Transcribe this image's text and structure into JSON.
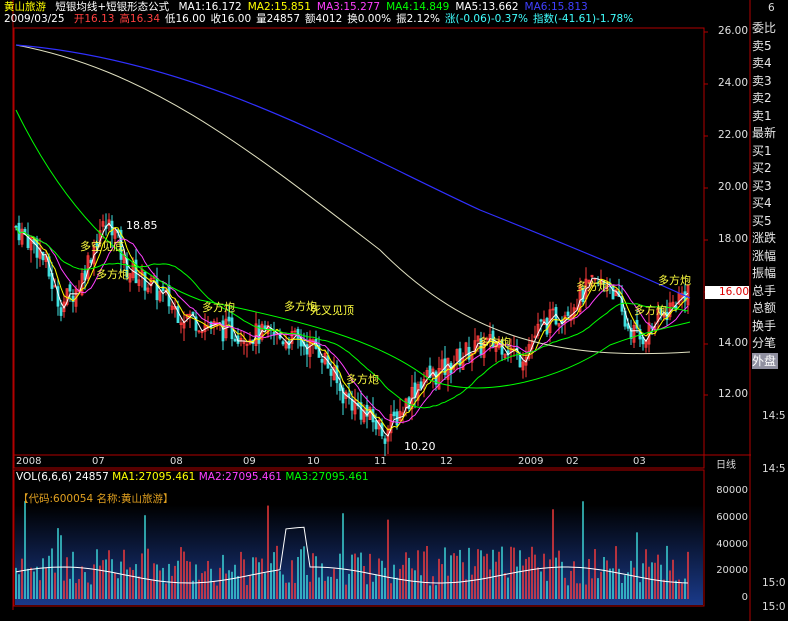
{
  "stock": {
    "name": "黄山旅游",
    "formula_name": "短银均线+短银形态公式",
    "date": "2009/03/25",
    "code_line": "【代码:600054  名称:黄山旅游】"
  },
  "indicators_top": [
    {
      "text": "MA1:16.172",
      "color": "#ffffff"
    },
    {
      "text": "MA2:15.851",
      "color": "#ffff00"
    },
    {
      "text": "MA3:15.277",
      "color": "#ff40ff"
    },
    {
      "text": "MA4:14.849",
      "color": "#00ff00"
    },
    {
      "text": "MA5:13.662",
      "color": "#ffffff"
    },
    {
      "text": "MA6:15.813",
      "color": "#4040ff"
    }
  ],
  "quote_line": [
    {
      "text": "开16.13",
      "color": "#ff4040"
    },
    {
      "text": "高16.34",
      "color": "#ff4040"
    },
    {
      "text": "低16.00",
      "color": "#ffffff"
    },
    {
      "text": "收16.00",
      "color": "#ffffff"
    },
    {
      "text": "量24857",
      "color": "#ffffff"
    },
    {
      "text": "额4012",
      "color": "#ffffff"
    },
    {
      "text": "换0.00%",
      "color": "#ffffff"
    },
    {
      "text": "振2.12%",
      "color": "#ffffff"
    },
    {
      "text": "涨(-0.06)-0.37%",
      "color": "#40ffff"
    },
    {
      "text": "指数(-41.61)-1.78%",
      "color": "#40ffff"
    }
  ],
  "price_axis": [
    "26.00",
    "24.00",
    "22.00",
    "20.00",
    "18.00",
    "16.00",
    "14.00",
    "12.00"
  ],
  "current_price": "16.00",
  "x_labels": [
    "2008",
    "07",
    "08",
    "09",
    "10",
    "11",
    "12",
    "2009",
    "02",
    "03",
    "日线"
  ],
  "annotations": [
    {
      "text": "18.85"
    },
    {
      "text": "多空见底"
    },
    {
      "text": "多方炮"
    },
    {
      "text": "多方炮"
    },
    {
      "text": "多方炮"
    },
    {
      "text": "死叉见顶"
    },
    {
      "text": "多方炮"
    },
    {
      "text": "多方炮"
    },
    {
      "text": "多方炮"
    },
    {
      "text": "多方炮"
    },
    {
      "text": "多方炮"
    },
    {
      "text": "10.20"
    }
  ],
  "volume": {
    "label": "VOL(6,6,6)",
    "value": "24857",
    "ma1": "MA1:27095.461",
    "ma2": "MA2:27095.461",
    "ma3": "MA3:27095.461",
    "axis": [
      "80000",
      "60000",
      "40000",
      "20000",
      "0"
    ]
  },
  "order_panel": [
    "委比",
    "卖5",
    "卖4",
    "卖3",
    "卖2",
    "卖1",
    "最新",
    "买1",
    "买2",
    "买3",
    "买4",
    "买5",
    "涨跌",
    "涨幅",
    "振幅",
    "总手",
    "总额",
    "换手",
    "分笔",
    "外盘"
  ],
  "right_edge_texts": [
    "6",
    "14:5",
    "14:5",
    "15:0",
    "15:0"
  ],
  "colors": {
    "up": "#ff3c3c",
    "down": "#40e0e0",
    "ma1": "#ffffff",
    "ma2": "#ffff00",
    "ma3": "#ff40ff",
    "ma4": "#00ff00",
    "ma5": "#e0e0c0",
    "ma6": "#3030ff",
    "frame": "#b00000"
  }
}
